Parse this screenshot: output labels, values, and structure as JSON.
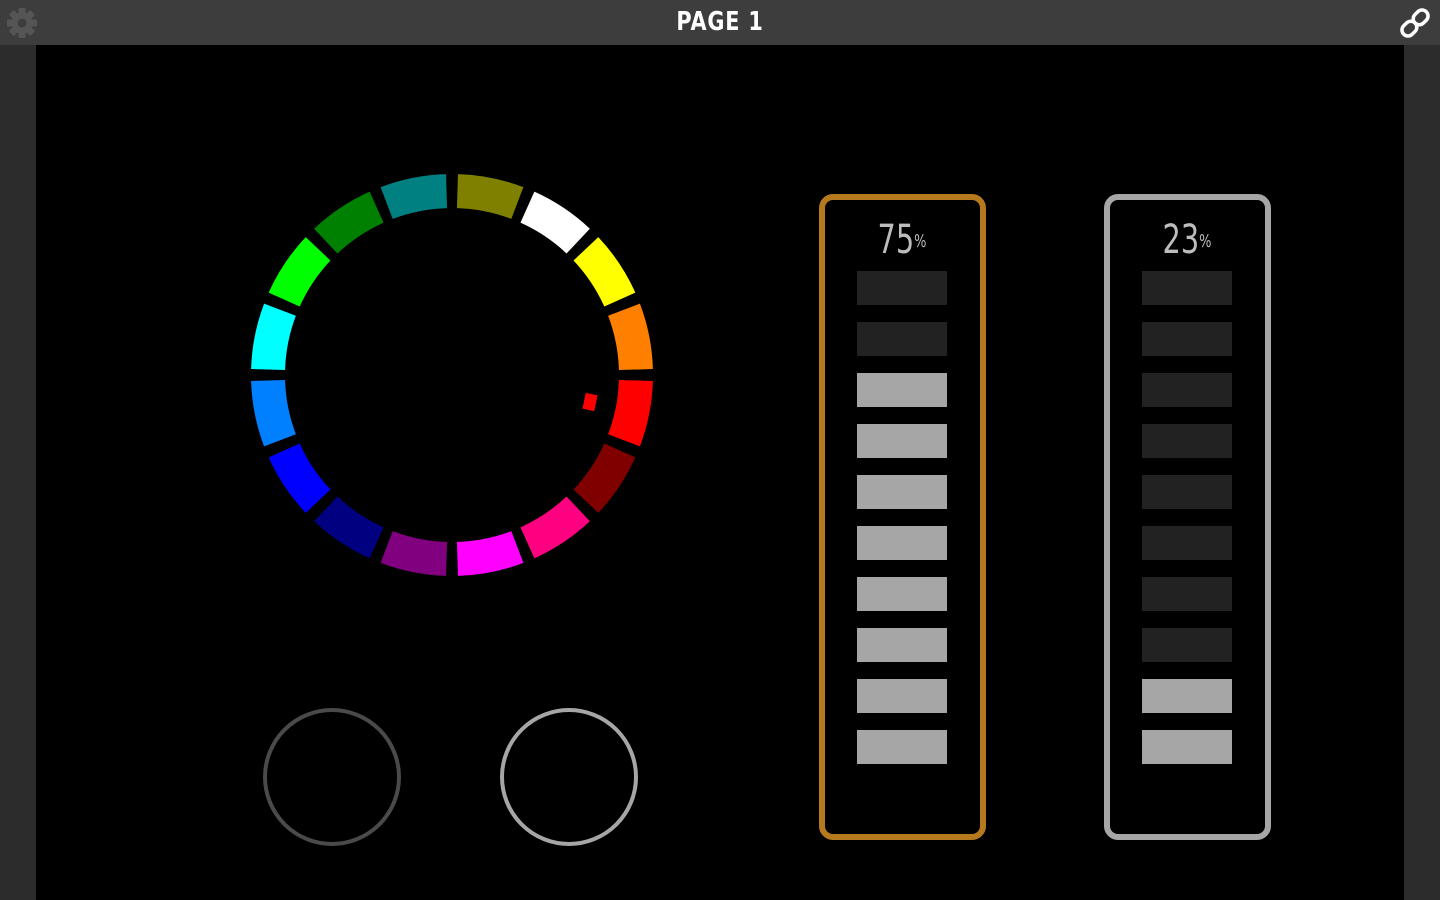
{
  "header": {
    "title": "PAGE 1",
    "left_icon": "gear-icon",
    "right_icon": "link-icon"
  },
  "colors": {
    "header_bg": "#3d3d3d",
    "frame_bg": "#2c2c2c",
    "canvas_bg": "#000000",
    "segment_on": "#a6a6a6",
    "segment_off": "#222222",
    "cursor": "#ff0000"
  },
  "color_wheel": {
    "swatches": [
      "#ff0000",
      "#800000",
      "#ff0080",
      "#ff00ff",
      "#800080",
      "#000080",
      "#0000ff",
      "#0080ff",
      "#00ffff",
      "#00ff00",
      "#008000",
      "#008080",
      "#808000",
      "#ffffff",
      "#ffff00",
      "#ff8000"
    ]
  },
  "knobs": [
    {
      "color": "#4a4a4a"
    },
    {
      "color": "#a6a6a6"
    }
  ],
  "meters": [
    {
      "value": "75",
      "unit": "%",
      "level": 0.75,
      "segments": 10,
      "lit_segments": 8,
      "border_color": "#b57a1e"
    },
    {
      "value": "23",
      "unit": "%",
      "level": 0.23,
      "segments": 10,
      "lit_segments": 2,
      "border_color": "#a6a6a6"
    }
  ]
}
